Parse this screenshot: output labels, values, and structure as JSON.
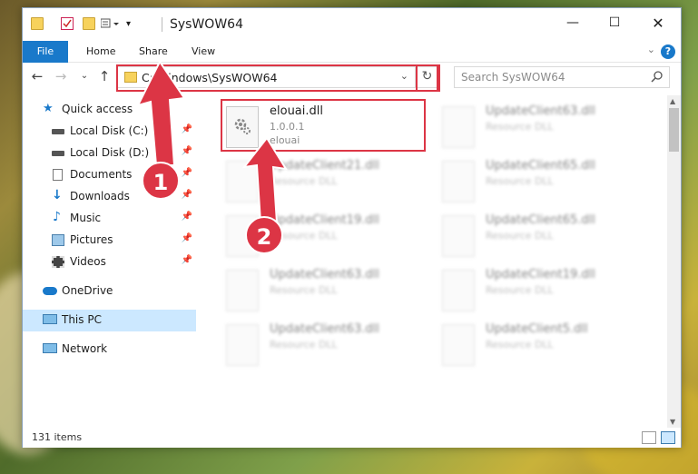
{
  "window": {
    "title": "SysWOW64"
  },
  "ribbon": {
    "tabs": [
      "File",
      "Home",
      "Share",
      "View"
    ],
    "help": "?"
  },
  "address": {
    "path": "C:\\Windows\\SysWOW64",
    "search_placeholder": "Search SysWOW64"
  },
  "sidebar": {
    "items": [
      {
        "label": "Quick access"
      },
      {
        "label": "Local Disk (C:)"
      },
      {
        "label": "Local Disk (D:)"
      },
      {
        "label": "Documents"
      },
      {
        "label": "Downloads"
      },
      {
        "label": "Music"
      },
      {
        "label": "Pictures"
      },
      {
        "label": "Videos"
      },
      {
        "label": "OneDrive"
      },
      {
        "label": "This PC"
      },
      {
        "label": "Network"
      }
    ]
  },
  "files": {
    "highlighted": {
      "name": "elouai.dll",
      "version": "1.0.0.1",
      "company": "elouai"
    },
    "left_column": [
      {
        "name": "UpdateClient21.dll",
        "type": "Resource DLL"
      },
      {
        "name": "UpdateClient19.dll",
        "type": "Resource DLL"
      },
      {
        "name": "UpdateClient63.dll",
        "type": "Resource DLL"
      },
      {
        "name": "UpdateClient63.dll",
        "type": "Resource DLL"
      }
    ],
    "right_column": [
      {
        "name": "UpdateClient63.dll",
        "type": "Resource DLL"
      },
      {
        "name": "UpdateClient65.dll",
        "type": "Resource DLL"
      },
      {
        "name": "UpdateClient65.dll",
        "type": "Resource DLL"
      },
      {
        "name": "UpdateClient19.dll",
        "type": "Resource DLL"
      },
      {
        "name": "UpdateClient5.dll",
        "type": "Resource DLL"
      }
    ]
  },
  "status": {
    "item_count": "131 items"
  },
  "callouts": [
    "1",
    "2"
  ],
  "colors": {
    "accent": "#1979ca",
    "callout": "#dc3545",
    "selected": "#cce8ff"
  }
}
